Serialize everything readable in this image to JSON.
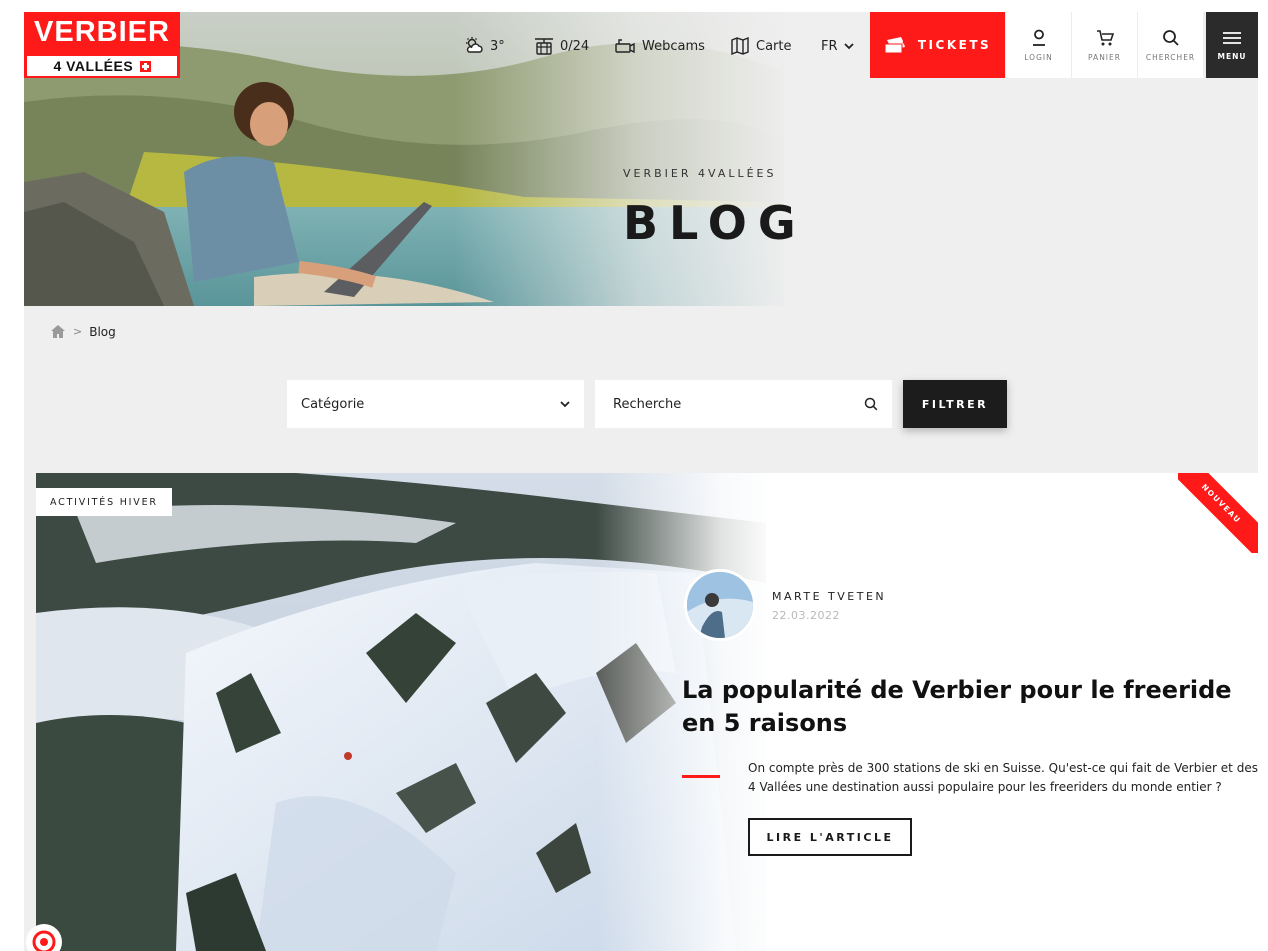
{
  "logo": {
    "line1": "VERBIER",
    "line2": "4 VALLÉES"
  },
  "topbar": {
    "weather": "3°",
    "lifts": "0/24",
    "webcams": "Webcams",
    "map": "Carte",
    "language": "FR",
    "tickets": "TICKETS",
    "login": "LOGIN",
    "cart": "PANIER",
    "search": "CHERCHER",
    "menu": "MENU"
  },
  "hero": {
    "eyebrow": "VERBIER 4VALLÉES",
    "title": "BLOG"
  },
  "breadcrumb": {
    "current": "Blog"
  },
  "filter": {
    "category_label": "Catégorie",
    "search_placeholder": "Recherche",
    "submit": "FILTRER"
  },
  "featured": {
    "category": "ACTIVITÉS HIVER",
    "ribbon": "NOUVEAU",
    "author": "MARTE TVETEN",
    "date": "22.03.2022",
    "title": "La popularité de Verbier pour le freeride en 5 raisons",
    "excerpt": "On compte près de 300 stations de ski en Suisse. Qu'est-ce qui fait de Verbier et des 4 Vallées une destination aussi populaire pour les freeriders du monde entier ?",
    "cta": "LIRE L'ARTICLE"
  },
  "colors": {
    "brand_red": "#ff1a1a",
    "dark": "#1c1c1c",
    "background": "#efefef"
  }
}
